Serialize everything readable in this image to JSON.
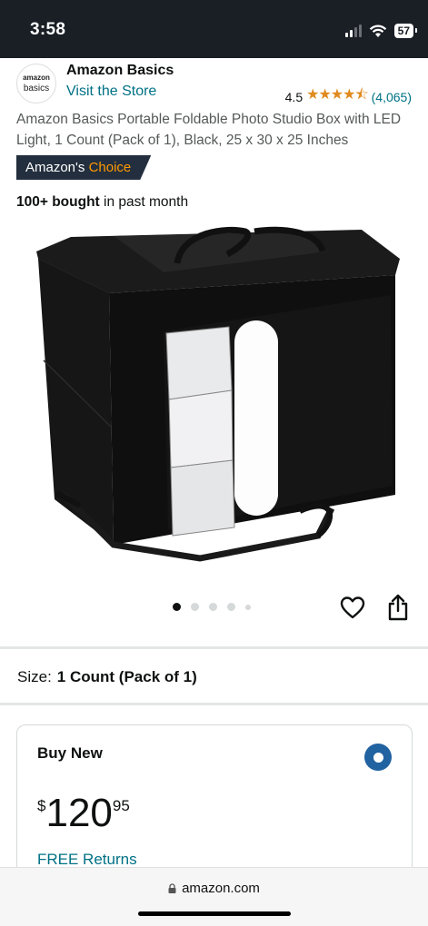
{
  "status_bar": {
    "time": "3:58",
    "battery": "57"
  },
  "brand": {
    "logo_line1": "amazon",
    "logo_line2": "basics",
    "name": "Amazon Basics",
    "visit_store": "Visit the Store",
    "rating": "4.5",
    "rating_count": "(4,065)",
    "stars": "★★★★⯪"
  },
  "product": {
    "title": "Amazon Basics Portable Foldable Photo Studio Box with LED Light, 1 Count (Pack of 1), Black, 25 x 30 x 25 Inches",
    "badge_prefix": "Amazon's",
    "badge_accent": "Choice",
    "bought_bold": "100+ bought",
    "bought_rest": "in past month",
    "image_count": 5,
    "active_image": 1
  },
  "size": {
    "label": "Size:",
    "value": "1 Count (Pack of 1)"
  },
  "buy_box": {
    "title": "Buy New",
    "currency": "$",
    "price_whole": "120",
    "price_fraction": "95",
    "free_returns": "FREE Returns",
    "selected": true
  },
  "browser": {
    "url": "amazon.com"
  },
  "colors": {
    "link": "#007185",
    "accent": "#ff9900",
    "star": "#e08a1f",
    "radio": "#2162a1",
    "status_bar": "#1a1f26"
  },
  "icons": {
    "heart": "heart-icon",
    "share": "share-icon",
    "lock": "lock-icon",
    "wifi": "wifi-icon",
    "signal": "signal-icon"
  }
}
